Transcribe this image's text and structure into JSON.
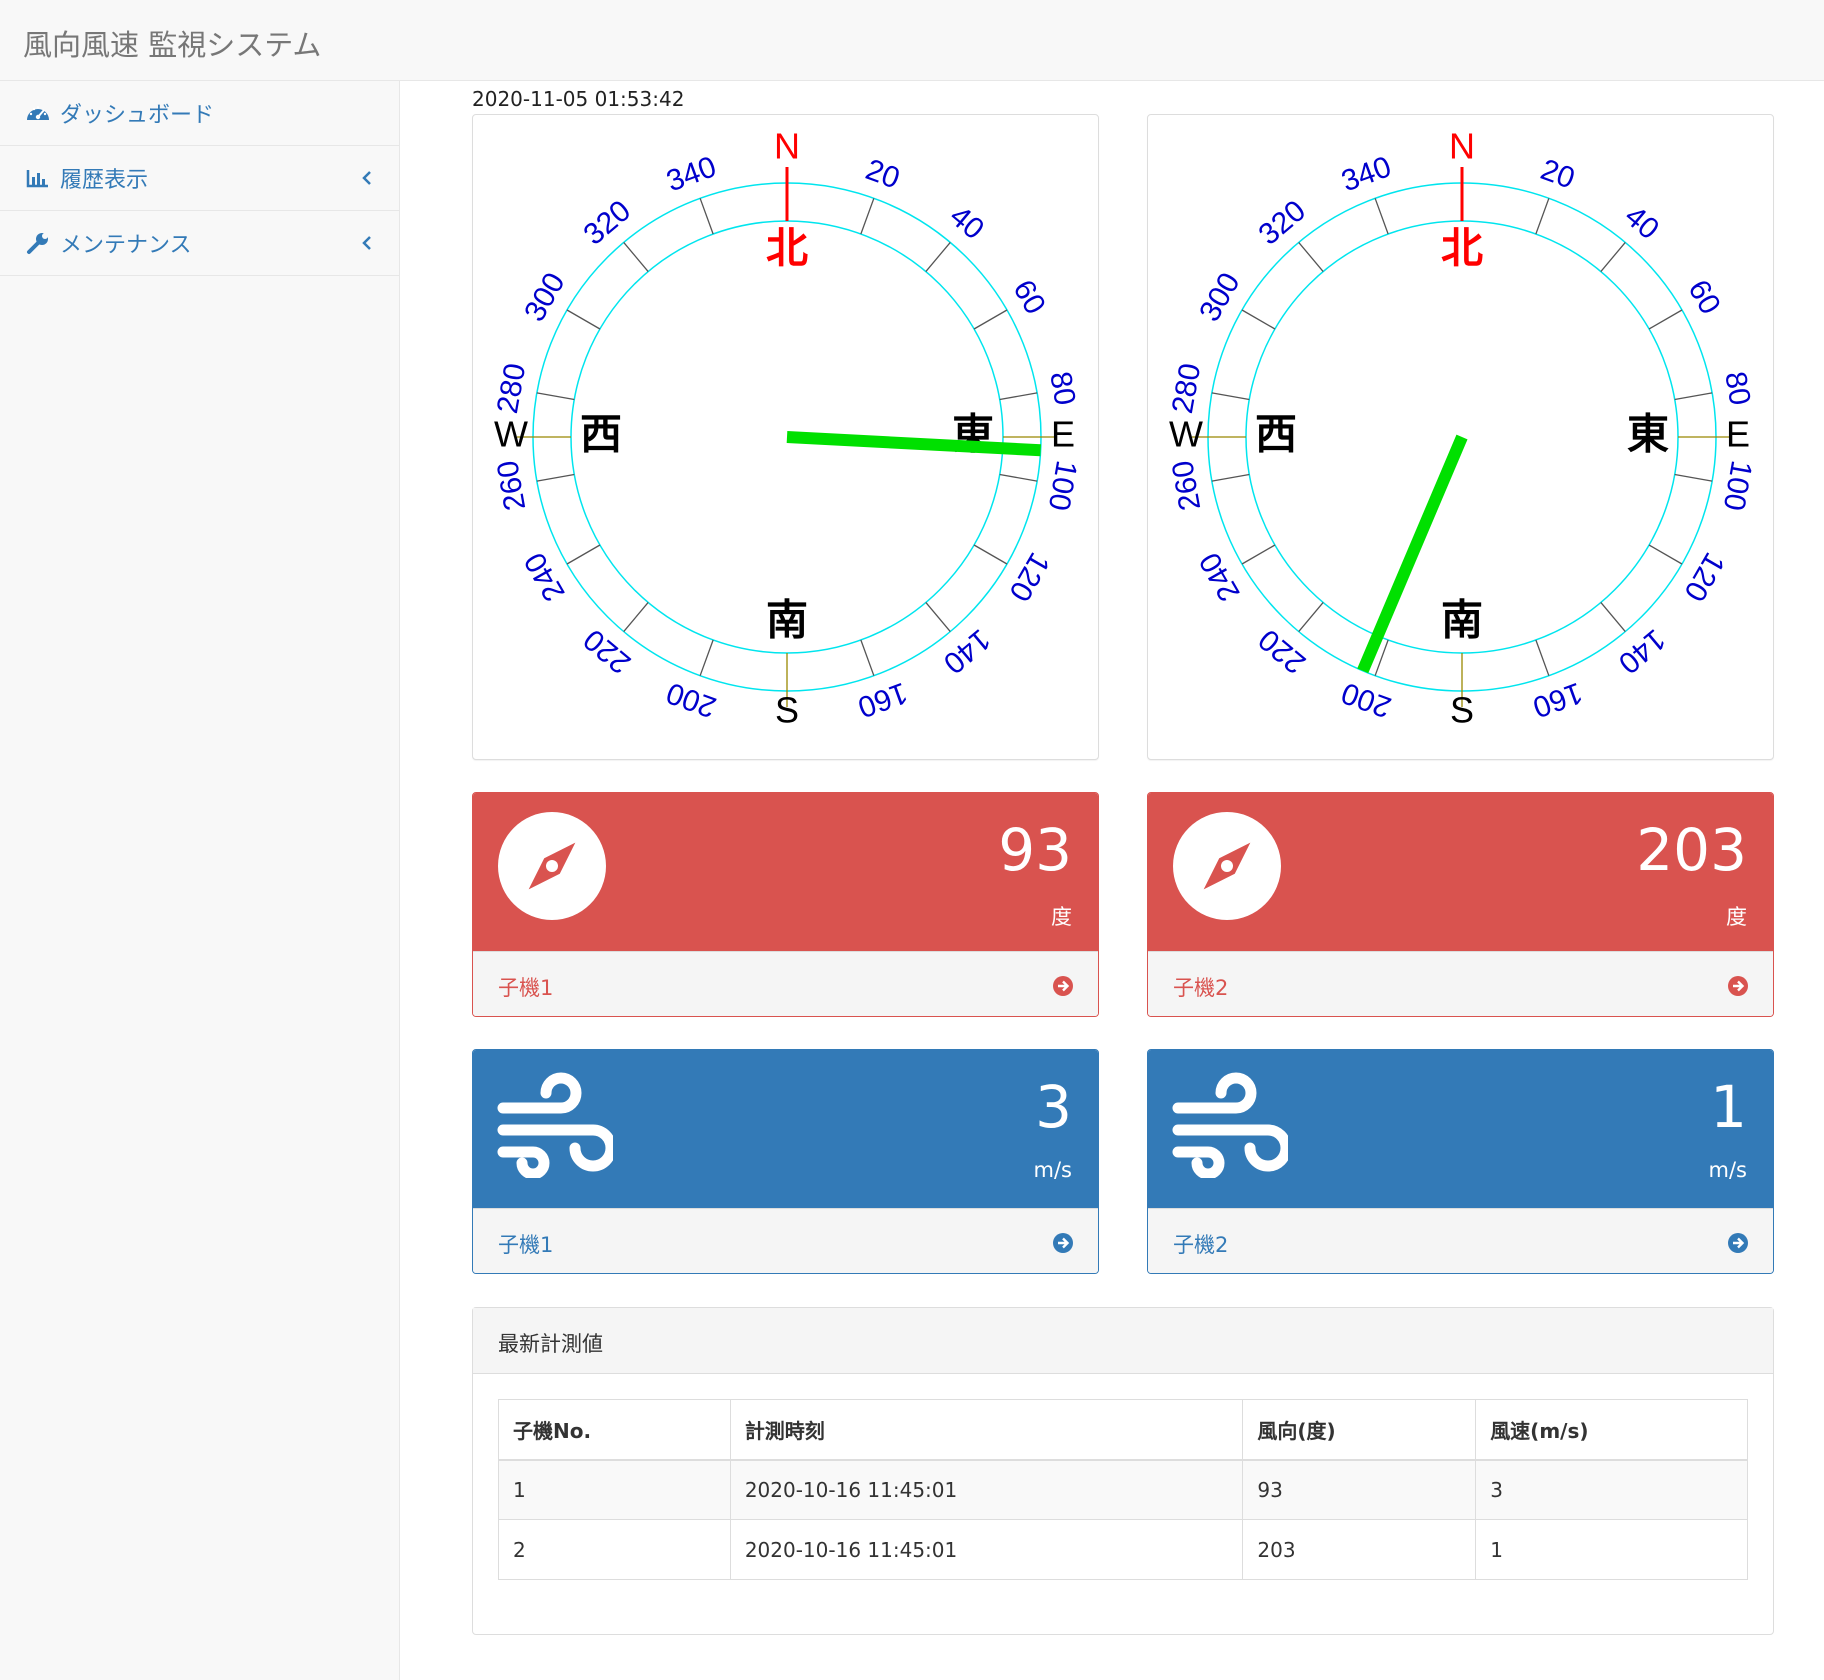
{
  "header": {
    "title": "風向風速 監視システム"
  },
  "sidebar": {
    "items": [
      {
        "label": "ダッシュボード",
        "icon": "dashboard-icon"
      },
      {
        "label": "履歴表示",
        "icon": "bar-chart-icon"
      },
      {
        "label": "メンテナンス",
        "icon": "wrench-icon"
      }
    ]
  },
  "main": {
    "timestamp": "2020-11-05 01:53:42",
    "compass": {
      "ring_color": "#00e5ee",
      "pointer_color": "#00e000",
      "north_color": "#ff0000",
      "tick_label_color": "#0000cc",
      "cardinals": {
        "N": "N",
        "E": "E",
        "S": "S",
        "W": "W"
      },
      "kanji": {
        "north": "北",
        "east": "東",
        "south": "南",
        "west": "西"
      },
      "tick_labels": [
        "20",
        "40",
        "60",
        "80",
        "100",
        "120",
        "140",
        "160",
        "200",
        "220",
        "240",
        "260",
        "280",
        "300",
        "320",
        "340"
      ],
      "units": [
        {
          "direction_deg": 93
        },
        {
          "direction_deg": 203
        }
      ]
    },
    "direction_cards": [
      {
        "value": "93",
        "unit": "度",
        "footer": "子機1"
      },
      {
        "value": "203",
        "unit": "度",
        "footer": "子機2"
      }
    ],
    "speed_cards": [
      {
        "value": "3",
        "unit": "m/s",
        "footer": "子機1"
      },
      {
        "value": "1",
        "unit": "m/s",
        "footer": "子機2"
      }
    ],
    "colors": {
      "danger": "#d9534f",
      "primary": "#337ab7"
    },
    "latest": {
      "title": "最新計測値",
      "columns": [
        "子機No.",
        "計測時刻",
        "風向(度)",
        "風速(m/s)"
      ],
      "rows": [
        [
          "1",
          "2020-10-16 11:45:01",
          "93",
          "3"
        ],
        [
          "2",
          "2020-10-16 11:45:01",
          "203",
          "1"
        ]
      ]
    }
  }
}
